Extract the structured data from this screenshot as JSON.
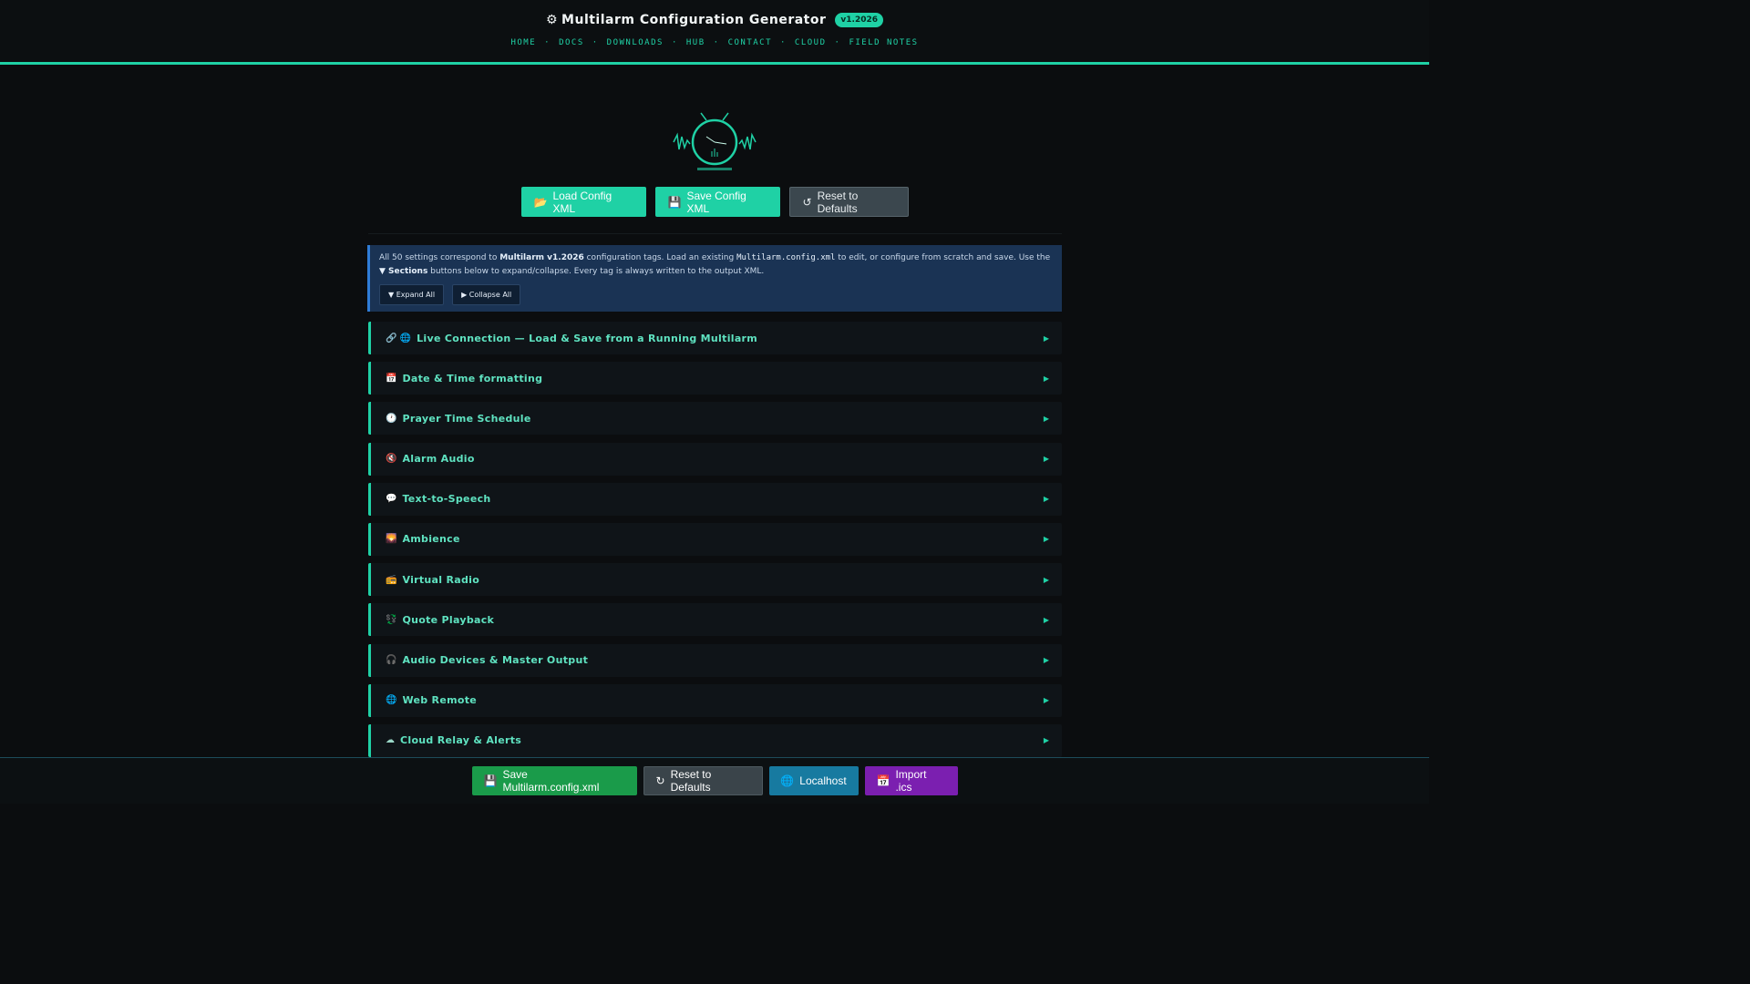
{
  "header": {
    "title": "Multilarm Configuration Generator",
    "gear_icon": "⚙",
    "version": "v1.2026",
    "nav": [
      "HOME",
      "DOCS",
      "DOWNLOADS",
      "HUB",
      "CONTACT",
      "CLOUD",
      "FIELD NOTES"
    ]
  },
  "actions": {
    "load": {
      "icon": "📂",
      "label": "Load Config XML"
    },
    "save": {
      "icon": "💾",
      "label": "Save Config XML"
    },
    "reset": {
      "icon": "↺",
      "label": "Reset to Defaults"
    }
  },
  "info": {
    "p1": "All 50 settings correspond to ",
    "brand": "Multilarm v1.2026",
    "p2": " configuration tags. Load an existing ",
    "file": "Multilarm.config.xml",
    "p3": " to edit, or configure from scratch and save. Use the ",
    "sections_word": "▼ Sections",
    "p4": " buttons below to expand/collapse. Every tag is always written to the output XML.",
    "expand": "▼ Expand All",
    "collapse": "▶ Collapse All"
  },
  "sections": [
    {
      "icon": "🔗 🌐",
      "label": "Live Connection — Load & Save from a Running Multilarm"
    },
    {
      "icon": "📅",
      "label": "Date & Time formatting"
    },
    {
      "icon": "🕐",
      "label": "Prayer Time Schedule"
    },
    {
      "icon": "🔇",
      "label": "Alarm Audio"
    },
    {
      "icon": "💬",
      "label": "Text-to-Speech"
    },
    {
      "icon": "🌄",
      "label": "Ambience"
    },
    {
      "icon": "📻",
      "label": "Virtual Radio"
    },
    {
      "icon": "💱",
      "label": "Quote Playback"
    },
    {
      "icon": "🎧",
      "label": "Audio Devices & Master Output"
    },
    {
      "icon": "🌐",
      "label": "Web Remote"
    },
    {
      "icon": "☁",
      "label": "Cloud Relay & Alerts"
    }
  ],
  "footer": {
    "save": {
      "icon": "💾",
      "label": "Save Multilarm.config.xml"
    },
    "reset": {
      "icon": "↻",
      "label": "Reset to Defaults"
    },
    "localhost": {
      "icon": "🌐",
      "label": "Localhost"
    },
    "import": {
      "icon": "📅",
      "label": "Import .ics"
    }
  },
  "colors": {
    "accent": "#1fd1a5",
    "background": "#0b0d0f",
    "info_bg": "#1a3354",
    "green": "#1a9b4a",
    "blue": "#177aa0",
    "purple": "#7b1fb0"
  }
}
